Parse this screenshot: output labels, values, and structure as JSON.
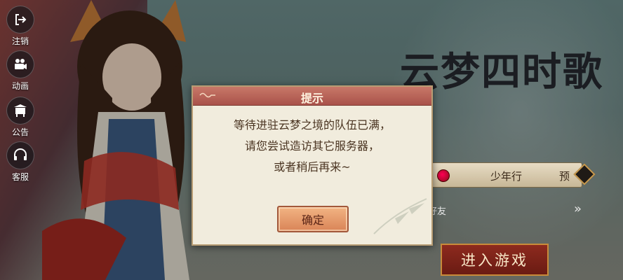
{
  "sidebar": {
    "items": [
      {
        "label": "注销",
        "icon": "logout-icon"
      },
      {
        "label": "动画",
        "icon": "film-camera-icon"
      },
      {
        "label": "公告",
        "icon": "notice-board-icon"
      },
      {
        "label": "客服",
        "icon": "headset-icon"
      }
    ]
  },
  "logo": {
    "text": "云梦四时歌"
  },
  "server": {
    "name": "少年行",
    "tag": "预"
  },
  "friend": {
    "text": "好友"
  },
  "enter": {
    "label": "进入游戏"
  },
  "dialog": {
    "title": "提示",
    "lines": [
      "等待进驻云梦之境的队伍已满，",
      "请您尝试造访其它服务器，",
      "或者稍后再来~"
    ],
    "confirm_label": "确定"
  }
}
